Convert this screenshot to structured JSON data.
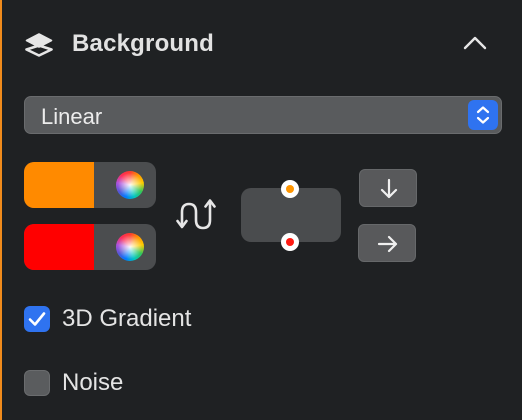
{
  "section": {
    "title": "Background",
    "icon": "layers-icon",
    "collapse_icon": "chevron-up-icon"
  },
  "gradient_type": {
    "selected": "Linear",
    "stepper_icon": "up-down-stepper-icon",
    "accent": "#2f73f0"
  },
  "colors": [
    {
      "name": "start-color",
      "hex": "#ff8a00",
      "picker_icon": "color-wheel-icon"
    },
    {
      "name": "end-color",
      "hex": "#ff0000",
      "picker_icon": "color-wheel-icon"
    }
  ],
  "swap_icon": "swap-arrows-icon",
  "direction_preview": {
    "start_handle_color": "#ff9500",
    "end_handle_color": "#ff1a12"
  },
  "direction_buttons": [
    {
      "name": "direction-down-button",
      "icon": "arrow-down-icon"
    },
    {
      "name": "direction-right-button",
      "icon": "arrow-right-icon"
    }
  ],
  "options": {
    "gradient_3d": {
      "label": "3D Gradient",
      "checked": true
    },
    "noise": {
      "label": "Noise",
      "checked": false
    }
  }
}
